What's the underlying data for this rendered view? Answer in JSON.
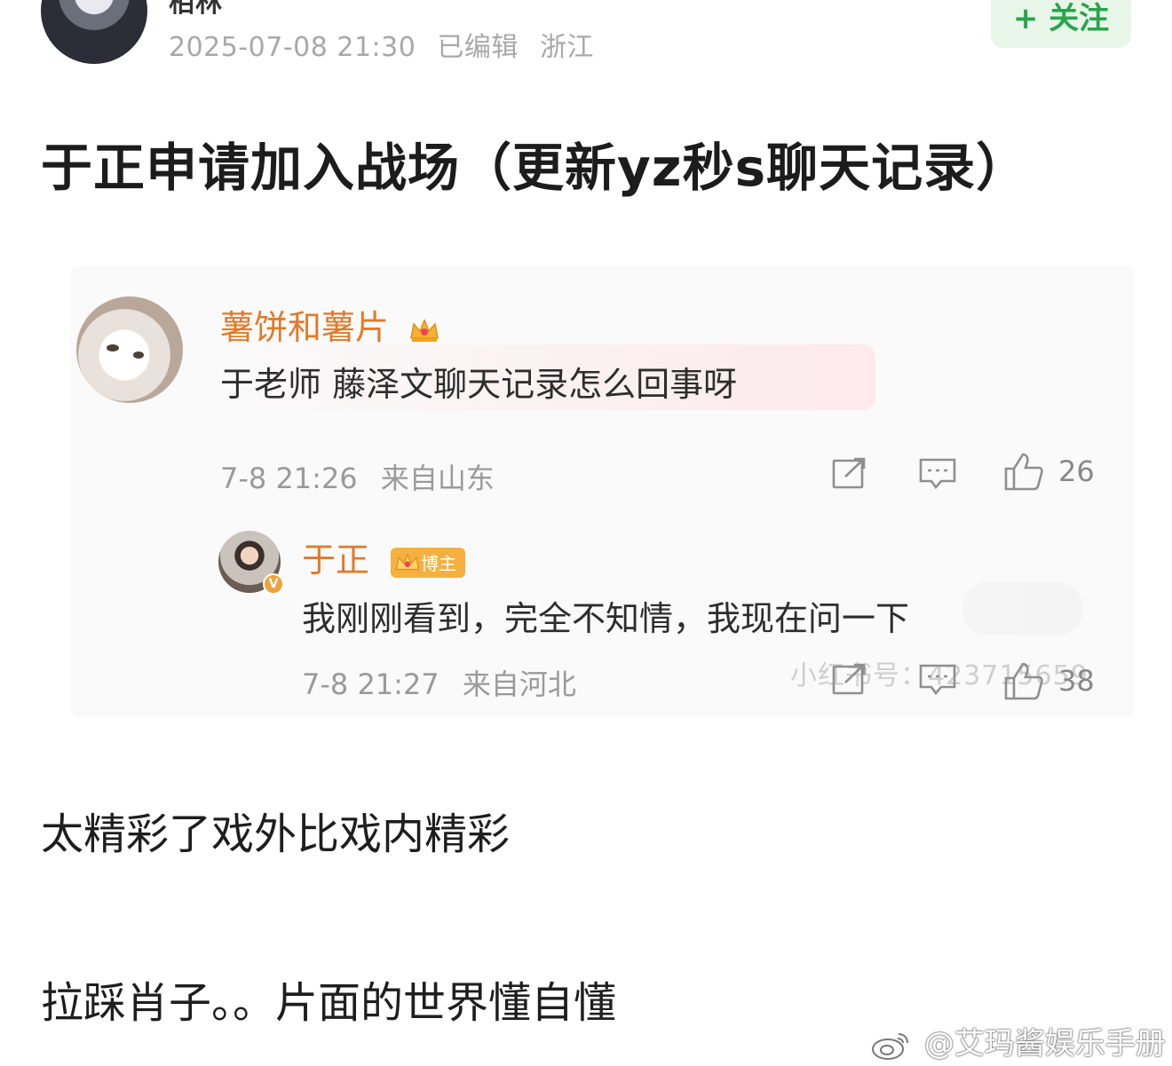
{
  "post": {
    "author_name": "栢林",
    "date": "2025-07-08 21:30",
    "edited": "已编辑",
    "location": "浙江",
    "follow_label": "+ 关注",
    "title": "于正申请加入战场（更新yz秒s聊天记录）",
    "paragraph_1": "太精彩了戏外比戏内精彩",
    "paragraph_2": "拉踩肖子。。片面的世界懂自懂"
  },
  "screenshot": {
    "comment_1": {
      "name": "薯饼和薯片",
      "text": "于老师 藤泽文聊天记录怎么回事呀",
      "time": "7-8 21:26",
      "location": "来自山东",
      "likes": "26"
    },
    "comment_2": {
      "name": "于正",
      "badge": "博主",
      "verified_mark": "V",
      "text": "我刚刚看到，完全不知情，我现在问一下",
      "time": "7-8 21:27",
      "location": "来自河北",
      "likes": "38",
      "inner_watermark": "小红书号：423715659"
    }
  },
  "watermark": "@艾玛酱娱乐手册",
  "colors": {
    "username": "#e07a2a",
    "follow_green": "#2aa44a",
    "follow_bg": "#e8f6ea",
    "meta_gray": "#a8a8a8"
  },
  "icons": [
    "share-icon",
    "comment-icon",
    "like-icon",
    "crown-icon",
    "weibo-icon"
  ]
}
